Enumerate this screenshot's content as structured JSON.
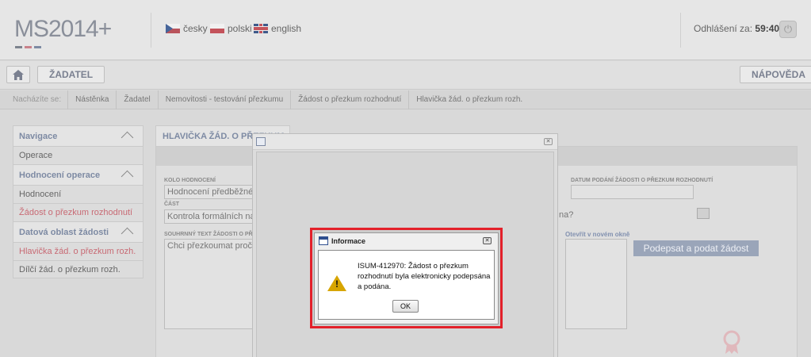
{
  "header": {
    "logo_text": "MS2014+",
    "languages": [
      {
        "label": "česky",
        "icon": "flag-cz-icon"
      },
      {
        "label": "polski",
        "icon": "flag-pl-icon"
      },
      {
        "label": "english",
        "icon": "flag-gb-icon"
      }
    ],
    "logout_label": "Odhlášení za:",
    "logout_time": "59:40"
  },
  "navbar": {
    "home_icon": "home-icon",
    "zadatel_label": "ŽADATEL",
    "napoveda_label": "NÁPOVĚDA"
  },
  "breadcrumb": {
    "label": "Nacházíte se:",
    "items": [
      "Nástěnka",
      "Žadatel",
      "Nemovitosti - testování přezkumu",
      "Žádost o přezkum rozhodnutí",
      "Hlavička žád. o přezkum rozh."
    ]
  },
  "sidebar": {
    "sections": [
      {
        "title": "Navigace",
        "items": [
          "Operace"
        ]
      },
      {
        "title": "Hodnocení operace",
        "items": [
          "Hodnocení",
          "Žádost o přezkum rozhodnutí"
        ]
      },
      {
        "title": "Datová oblast žádosti",
        "items": [
          "Hlavička žád. o přezkum rozh.",
          "Dílčí žád. o přezkum rozh."
        ]
      }
    ]
  },
  "content": {
    "tab_title": "HLAVIČKA ŽÁD. O PŘEZKUM ROZH.",
    "kolo_label": "KOLO HODNOCENÍ",
    "kolo_value": "Hodnocení předběžné žádo",
    "cast_label": "ČÁST",
    "cast_value": "Kontrola formálních náležit",
    "text_label": "SOUHRNNÝ TEXT ŽÁDOSTI O PŘEZ",
    "text_value": "Chci přezkoumat proč byl",
    "date_label": "DATUM PODÁNÍ ŽÁDOSTI O PŘEZKUM ROZHODNUTÍ",
    "question_tail": "na?",
    "newwin_link": "Otevřít v novém okně",
    "submit_label": "Podepsat a podat žádost"
  },
  "dialog": {
    "title": "Informace",
    "message": "ISUM-412970: Žádost o přezkum rozhodnutí byla elektronicky podepsána a podána.",
    "ok_label": "OK",
    "icon": "warning-icon"
  },
  "colors": {
    "highlight": "#e3202a",
    "accent_link": "#c86a74",
    "header_text": "#7d8aa3"
  }
}
